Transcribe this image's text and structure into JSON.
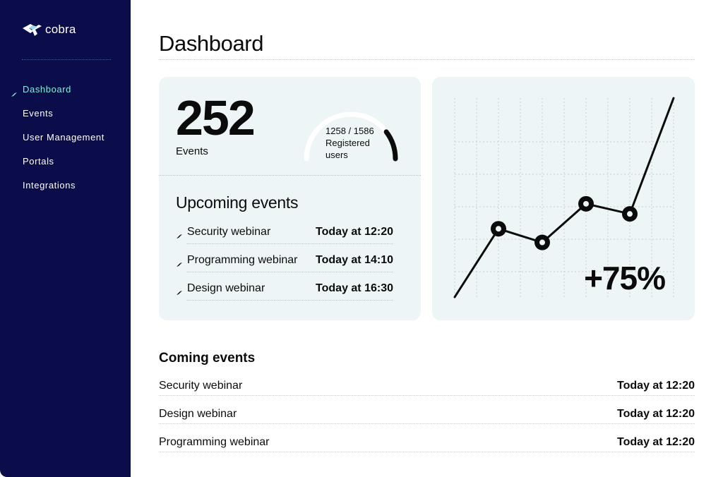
{
  "app": {
    "logo_text": "cobra"
  },
  "sidebar": {
    "items": [
      {
        "label": "Dashboard",
        "active": true
      },
      {
        "label": "Events",
        "active": false
      },
      {
        "label": "User Management",
        "active": false
      },
      {
        "label": "Portals",
        "active": false
      },
      {
        "label": "Integrations",
        "active": false
      }
    ]
  },
  "page": {
    "title": "Dashboard"
  },
  "stats": {
    "events_count": "252",
    "events_label": "Events",
    "registered": "1258 / 1586",
    "registered_label_1": "Registered",
    "registered_label_2": "users",
    "registered_fraction": 0.793
  },
  "upcoming": {
    "title": "Upcoming events",
    "items": [
      {
        "name": "Security webinar",
        "time": "Today at 12:20"
      },
      {
        "name": "Programming webinar",
        "time": "Today at 14:10"
      },
      {
        "name": "Design webinar",
        "time": "Today at 16:30"
      }
    ]
  },
  "chart_data": {
    "type": "line",
    "x": [
      0,
      1,
      2,
      3,
      4,
      5
    ],
    "values": [
      0,
      1.15,
      0.92,
      1.57,
      1.4,
      3.35
    ],
    "annotation": "+75%",
    "markers_at": [
      1,
      2,
      3,
      4
    ],
    "grid": true
  },
  "coming": {
    "title": "Coming events",
    "items": [
      {
        "name": "Security webinar",
        "time": "Today at 12:20"
      },
      {
        "name": "Design webinar",
        "time": "Today at 12:20"
      },
      {
        "name": "Programming webinar",
        "time": "Today at 12:20"
      }
    ]
  },
  "colors": {
    "sidebar_bg": "#0a0d4a",
    "accent": "#7ff0dc",
    "card_bg": "#edf5f6",
    "text": "#0b0b0b"
  }
}
